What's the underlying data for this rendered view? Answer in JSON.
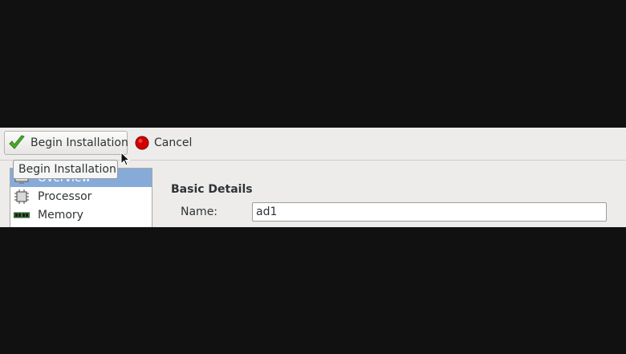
{
  "toolbar": {
    "begin_installation_label": "Begin Installation",
    "cancel_label": "Cancel"
  },
  "tooltip": {
    "text": "Begin Installation"
  },
  "sidebar": {
    "items": [
      {
        "label": "Overview",
        "icon": "overview-icon",
        "selected": true
      },
      {
        "label": "Processor",
        "icon": "processor-icon",
        "selected": false
      },
      {
        "label": "Memory",
        "icon": "memory-icon",
        "selected": false
      }
    ]
  },
  "details": {
    "heading": "Basic Details",
    "name_label": "Name:",
    "name_value": "ad1"
  },
  "colors": {
    "selection": "#86abd9",
    "checkmark": "#4caf2a",
    "cancel_red": "#d40000",
    "background": "#111111",
    "window": "#edeceb"
  }
}
